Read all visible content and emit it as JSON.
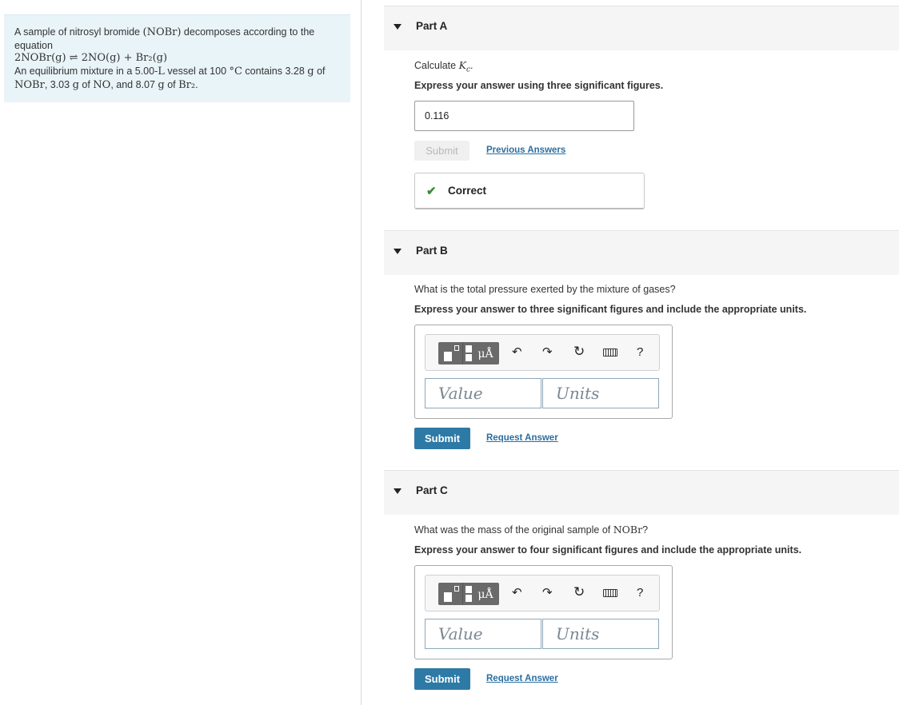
{
  "problem": {
    "intro": "A sample of nitrosyl bromide ",
    "intro_formula": "(NOBr)",
    "intro_rest": " decomposes according to the equation",
    "equation": "2NOBr(g) ⇌ 2NO(g) + Br₂(g)",
    "mixture_1": "An equilibrium mixture in a 5.00-",
    "mixture_L": "L",
    "mixture_2": " vessel at 100 ",
    "mixture_deg": "°C",
    "mixture_3": " contains 3.28 ",
    "mixture_g1": "g",
    "mixture_4": " of",
    "line3_nobr": "NOBr",
    "line3_a": ", 3.03 ",
    "line3_g2": "g",
    "line3_b": " of ",
    "line3_no": "NO",
    "line3_c": ", and 8.07 ",
    "line3_g3": "g",
    "line3_d": " of ",
    "line3_br2": "Br₂",
    "line3_e": "."
  },
  "parts": {
    "a": {
      "title": "Part A",
      "question_pre": "Calculate ",
      "question_var": "K",
      "question_sub": "c",
      "question_post": ".",
      "instruction": "Express your answer using three significant figures.",
      "answer": "0.116",
      "submit_label": "Submit",
      "previous_answers": "Previous Answers",
      "feedback": "Correct"
    },
    "b": {
      "title": "Part B",
      "question": "What is the total pressure exerted by the mixture of gases?",
      "instruction": "Express your answer to three significant figures and include the appropriate units.",
      "value_placeholder": "Value",
      "units_placeholder": "Units",
      "submit_label": "Submit",
      "request_answer": "Request Answer"
    },
    "c": {
      "title": "Part C",
      "question_pre": "What was the mass of the original sample of ",
      "question_formula": "NOBr",
      "question_post": "?",
      "instruction": "Express your answer to four significant figures and include the appropriate units.",
      "value_placeholder": "Value",
      "units_placeholder": "Units",
      "submit_label": "Submit",
      "request_answer": "Request Answer"
    }
  },
  "toolbar": {
    "units_button": "μÅ",
    "undo_icon": "↶",
    "redo_icon": "↷",
    "reset_icon": "↻",
    "help_label": "?"
  },
  "colors": {
    "problem_bg": "#e9f4f8",
    "submit_bg": "#2e7aa6",
    "link": "#2b6ea0",
    "correct_check": "#3c8c3c"
  }
}
